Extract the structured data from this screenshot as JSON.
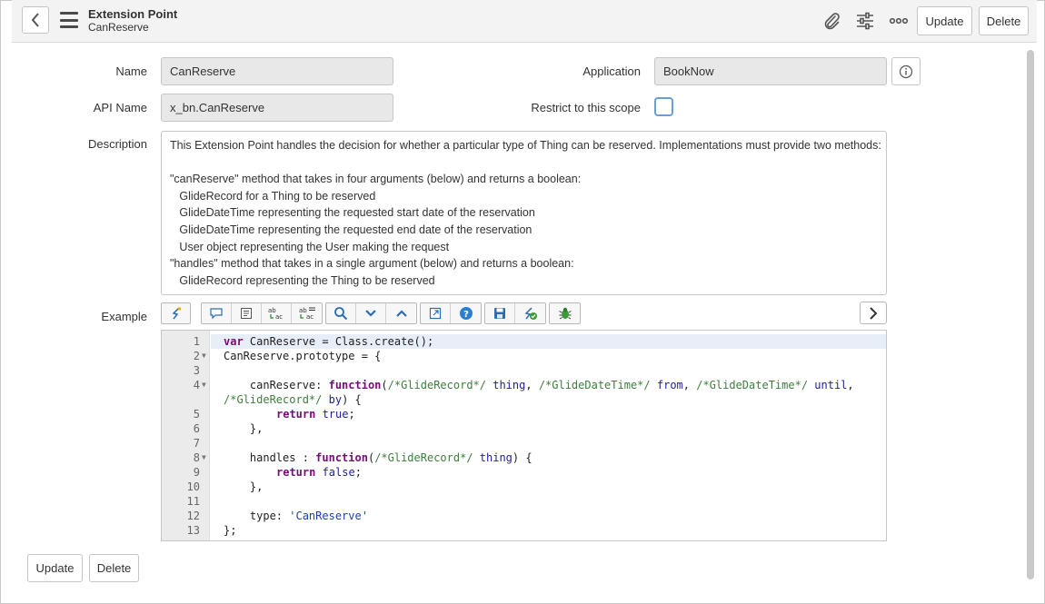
{
  "header": {
    "title": "Extension Point",
    "subtitle": "CanReserve",
    "update_label": "Update",
    "delete_label": "Delete"
  },
  "form": {
    "name_label": "Name",
    "name_value": "CanReserve",
    "api_name_label": "API Name",
    "api_name_value": "x_bn.CanReserve",
    "application_label": "Application",
    "application_value": "BookNow",
    "restrict_label": "Restrict to this scope",
    "restrict_checked": false,
    "description_label": "Description",
    "description_lines": [
      "This Extension Point handles the decision for whether a particular type of Thing can be reserved. Implementations must provide two methods:",
      "",
      "\"canReserve\" method that takes in four arguments (below) and returns a boolean:",
      "   GlideRecord for a Thing to be reserved",
      "   GlideDateTime representing the requested start date of the reservation",
      "   GlideDateTime representing the requested end date of the reservation",
      "   User object representing the User making the request",
      "\"handles\" method that takes in a single argument (below) and returns a boolean:",
      "   GlideRecord representing the Thing to be reserved"
    ],
    "example_label": "Example"
  },
  "toolbar": {
    "icons": [
      "format-code-icon",
      "comment-icon",
      "document-icon",
      "replace-icon",
      "replace-all-icon",
      "search-icon",
      "chevron-down-icon",
      "chevron-up-icon",
      "fullscreen-icon",
      "help-icon",
      "save-icon",
      "script-check-icon",
      "debug-icon",
      "chevron-right-icon"
    ]
  },
  "code": {
    "lines": [
      {
        "n": "1",
        "fold": false
      },
      {
        "n": "2",
        "fold": true
      },
      {
        "n": "3",
        "fold": false
      },
      {
        "n": "4",
        "fold": true
      },
      {
        "n": "",
        "fold": false
      },
      {
        "n": "5",
        "fold": false
      },
      {
        "n": "6",
        "fold": false
      },
      {
        "n": "7",
        "fold": false
      },
      {
        "n": "8",
        "fold": true
      },
      {
        "n": "9",
        "fold": false
      },
      {
        "n": "10",
        "fold": false
      },
      {
        "n": "11",
        "fold": false
      },
      {
        "n": "12",
        "fold": false
      },
      {
        "n": "13",
        "fold": false
      }
    ],
    "text": {
      "l1_kw": "var",
      "l1_rest": " CanReserve = Class.create();",
      "l2": "CanReserve.prototype = {",
      "l4_a": "    canReserve: ",
      "l4_fn": "function",
      "l4_p1": "(",
      "l4_c1": "/*GlideRecord*/",
      "l4_a1": " thing",
      "l4_sep1": ", ",
      "l4_c2": "/*GlideDateTime*/",
      "l4_a2": " from",
      "l4_sep2": ", ",
      "l4_c3": "/*GlideDateTime*/",
      "l4_a3": " until",
      "l4_sep3": ",",
      "l4b_c": "/*GlideRecord*/",
      "l4b_a": " by",
      "l4b_rest": ") {",
      "l5_ret": "return",
      "l5_val": " true",
      "l5_end": ";",
      "l6": "    },",
      "l8_a": "    handles : ",
      "l8_fn": "function",
      "l8_p": "(",
      "l8_c": "/*GlideRecord*/",
      "l8_arg": " thing",
      "l8_end": ") {",
      "l9_ret": "return",
      "l9_val": " false",
      "l9_end": ";",
      "l10": "    },",
      "l12_a": "    type: ",
      "l12_str": "'CanReserve'",
      "l13": "};"
    }
  },
  "footer": {
    "update_label": "Update",
    "delete_label": "Delete"
  }
}
